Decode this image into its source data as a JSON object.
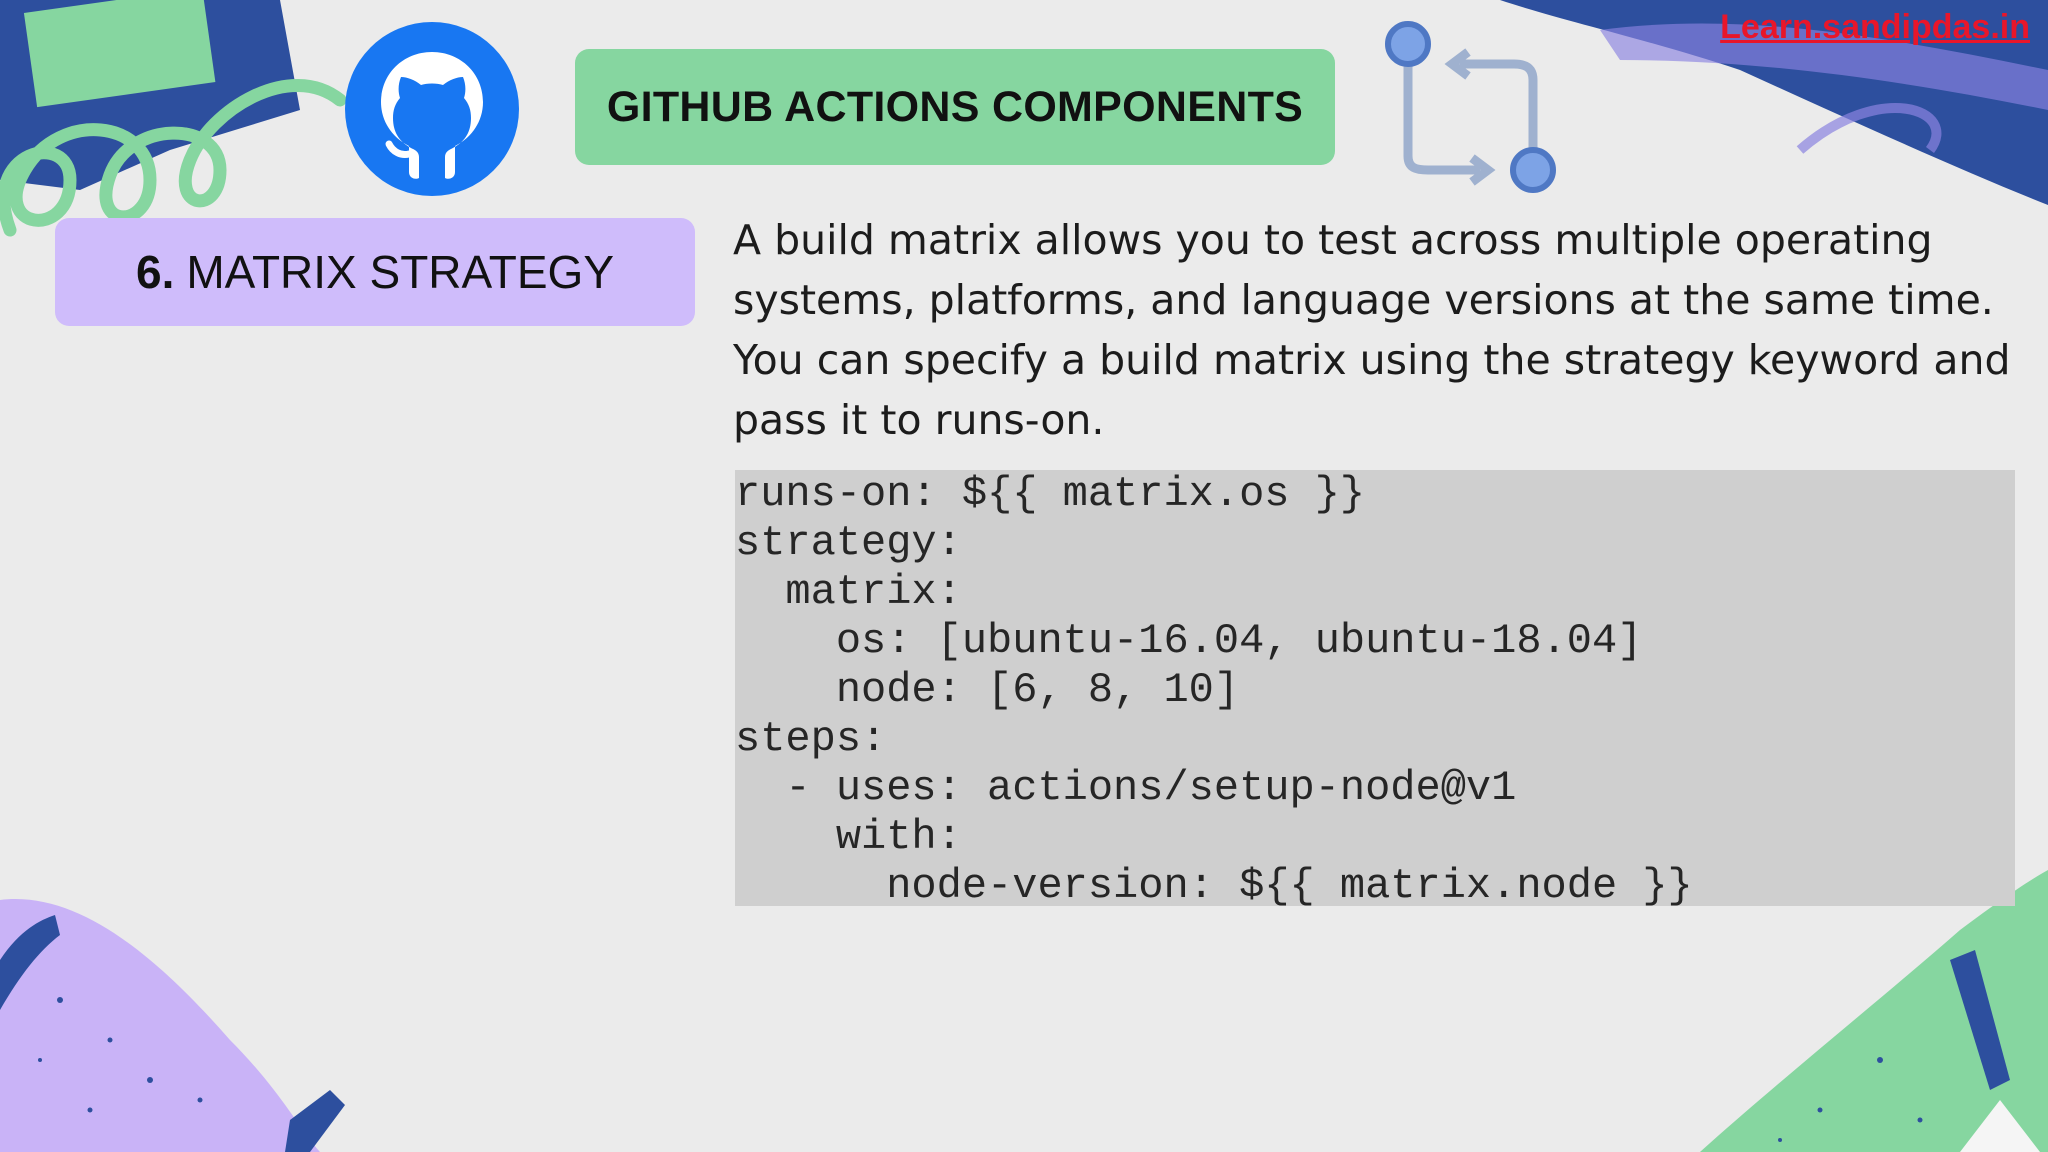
{
  "header": {
    "title": "GITHUB ACTIONS COMPONENTS",
    "site_link": "Learn.sandipdas.in"
  },
  "section": {
    "number": "6.",
    "title": "MATRIX STRATEGY"
  },
  "description": "A build matrix allows you to test across multiple operating systems, platforms, and language versions at the same time. You can specify a build matrix using the strategy keyword and pass it to runs-on.",
  "code_lines": [
    "runs-on: ${{ matrix.os }}",
    "strategy:",
    "  matrix:",
    "    os: [ubuntu-16.04, ubuntu-18.04]",
    "    node: [6, 8, 10]",
    "steps:",
    "  - uses: actions/setup-node@v1",
    "    with:",
    "      node-version: ${{ matrix.node }}"
  ],
  "icons": {
    "github": "github-octocat-icon",
    "workflow": "git-compare-icon"
  },
  "colors": {
    "title_pill": "#86d6a0",
    "section_pill": "#cfbcfb",
    "link": "#e8162a",
    "github_blue": "#1877f2",
    "code_bg": "#cfcfcf",
    "background": "#ebebeb"
  }
}
